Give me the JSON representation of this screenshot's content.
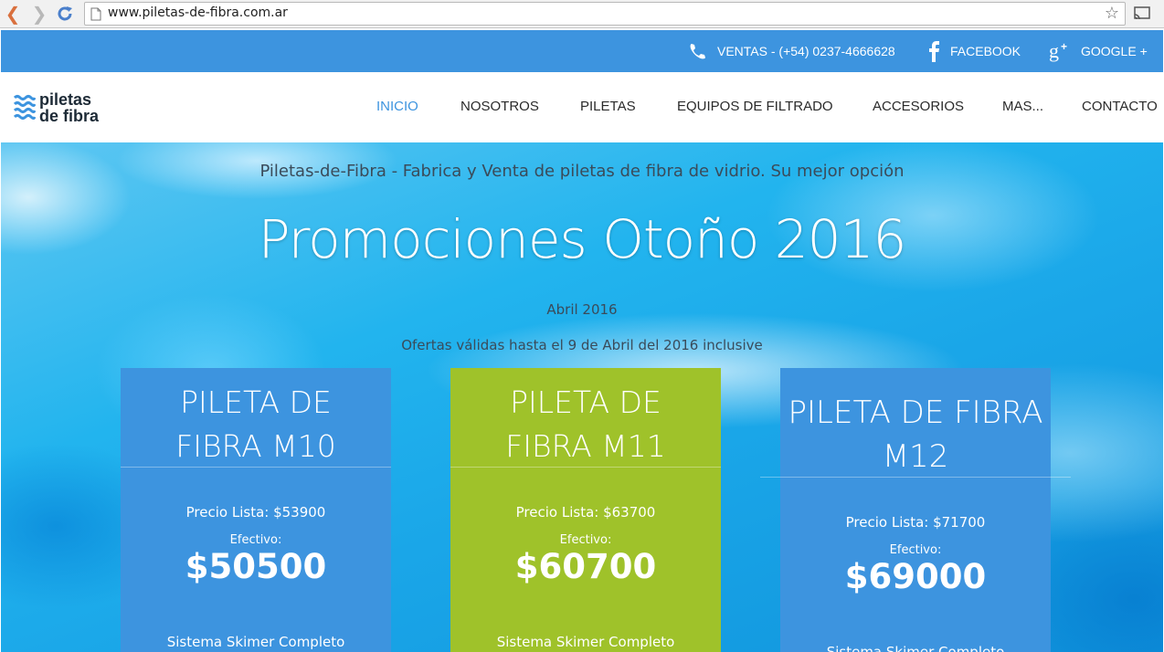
{
  "browser": {
    "url": "www.piletas-de-fibra.com.ar"
  },
  "topbar": {
    "phone": "VENTAS - (+54) 0237-4666628",
    "facebook": "FACEBOOK",
    "google": "GOOGLE +"
  },
  "logo": {
    "line1": "piletas",
    "line2": "de fibra"
  },
  "nav": {
    "items": [
      {
        "label": "INICIO",
        "active": true
      },
      {
        "label": "NOSOTROS"
      },
      {
        "label": "PILETAS"
      },
      {
        "label": "EQUIPOS DE FILTRADO"
      },
      {
        "label": "ACCESORIOS"
      },
      {
        "label": "MAS..."
      },
      {
        "label": "CONTACTO"
      }
    ]
  },
  "hero": {
    "tagline": "Piletas-de-Fibra - Fabrica y Venta de piletas de fibra de vidrio. Su mejor opción",
    "title": "Promociones Otoño 2016",
    "date": "Abril 2016",
    "offer": "Ofertas válidas hasta el 9 de Abril del 2016 inclusive"
  },
  "cards": [
    {
      "title_line1": "PILETA DE",
      "title_line2": "FIBRA M10",
      "list_price": "Precio Lista: $53900",
      "cash_label": "Efectivo:",
      "price": "$50500",
      "feature": "Sistema Skimer Completo",
      "color": "#3d94df"
    },
    {
      "title_line1": "PILETA DE",
      "title_line2": "FIBRA M11",
      "list_price": "Precio Lista: $63700",
      "cash_label": "Efectivo:",
      "price": "$60700",
      "feature": "Sistema Skimer Completo",
      "color": "#9fc22a"
    },
    {
      "title_line1": "PILETA DE FIBRA",
      "title_line2": "M12",
      "list_price": "Precio Lista: $71700",
      "cash_label": "Efectivo:",
      "price": "$69000",
      "feature": "Sistema Skimer Completo",
      "color": "#3d94df"
    }
  ],
  "colors": {
    "brand_blue": "#3d94df",
    "brand_green": "#9fc22a"
  }
}
